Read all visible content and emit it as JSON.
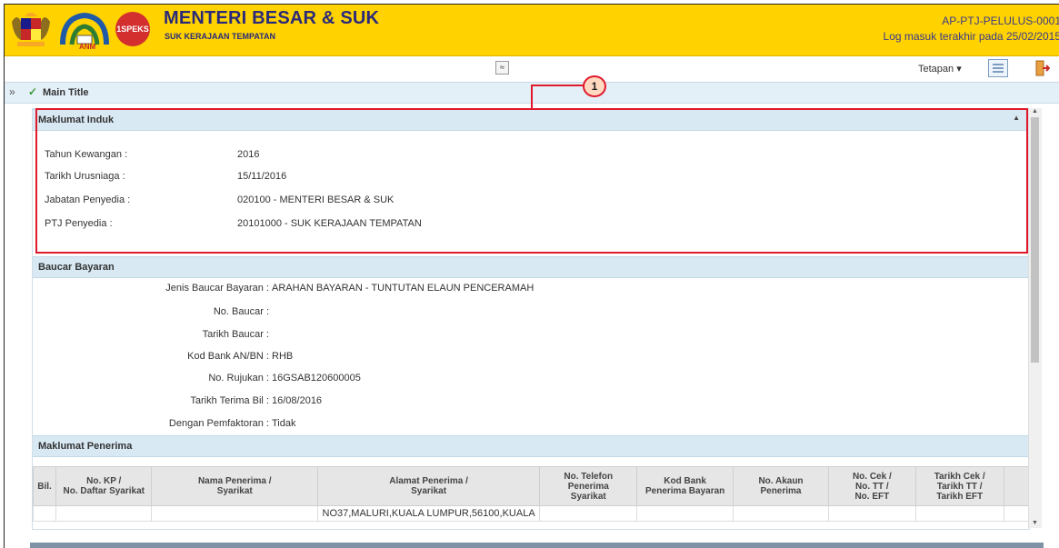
{
  "header": {
    "title": "MENTERI BESAR & SUK",
    "subtitle": "SUK KERAJAAN TEMPATAN",
    "user_id": "AP-PTJ-PELULUS-0001",
    "last_login": "Log masuk terakhir pada 25/02/2015",
    "logo_anm_text": "ANM",
    "logo_spek_text": "1SPEKS"
  },
  "toolbar": {
    "collapse_symbol": "≈",
    "settings_label": "Tetapan ▾"
  },
  "breadcrumb": {
    "expand_symbol": "»",
    "check_symbol": "✓",
    "main_title": "Main Title"
  },
  "annotation": {
    "marker": "1"
  },
  "maklumat_induk": {
    "heading": "Maklumat Induk",
    "collapse_symbol": "▲",
    "fields": [
      {
        "label": "Tahun Kewangan :",
        "value": "2016"
      },
      {
        "label": "Tarikh Urusniaga :",
        "value": "15/11/2016"
      },
      {
        "label": "Jabatan Penyedia :",
        "value": "020100 - MENTERI BESAR & SUK"
      },
      {
        "label": "PTJ Penyedia :",
        "value": "20101000 - SUK KERAJAAN TEMPATAN"
      }
    ]
  },
  "baucar_bayaran": {
    "heading": "Baucar Bayaran",
    "fields": [
      {
        "label": "Jenis Baucar Bayaran :",
        "value": "ARAHAN BAYARAN - TUNTUTAN ELAUN PENCERAMAH"
      },
      {
        "label": "No. Baucar :",
        "value": ""
      },
      {
        "label": "Tarikh Baucar :",
        "value": ""
      },
      {
        "label": "Kod Bank AN/BN :",
        "value": "RHB"
      },
      {
        "label": "No. Rujukan :",
        "value": "16GSAB120600005"
      },
      {
        "label": "Tarikh Terima Bil :",
        "value": "16/08/2016"
      },
      {
        "label": "Dengan Pemfaktoran :",
        "value": "Tidak"
      }
    ]
  },
  "maklumat_penerima": {
    "heading": "Maklumat Penerima",
    "columns": [
      [
        "Bil."
      ],
      [
        "No. KP /",
        "No. Daftar Syarikat"
      ],
      [
        "Nama Penerima /",
        "Syarikat"
      ],
      [
        "Alamat Penerima /",
        "Syarikat"
      ],
      [
        "No. Telefon Penerima",
        "Syarikat"
      ],
      [
        "Kod Bank",
        "Penerima Bayaran"
      ],
      [
        "No. Akaun",
        "Penerima"
      ],
      [
        "No. Cek /",
        "No. TT /",
        "No. EFT"
      ],
      [
        "Tarikh Cek /",
        "Tarikh TT /",
        "Tarikh EFT"
      ]
    ],
    "rows": [
      [
        "",
        "",
        "",
        "NO37,MALURI,KUALA LUMPUR,56100,KUALA",
        "",
        "",
        "",
        "",
        ""
      ]
    ]
  },
  "colors": {
    "header_bg": "#ffd200",
    "title_color": "#2a2a7a",
    "annotation_red": "#e0192c",
    "section_head_bg": "#d8e9f4"
  }
}
